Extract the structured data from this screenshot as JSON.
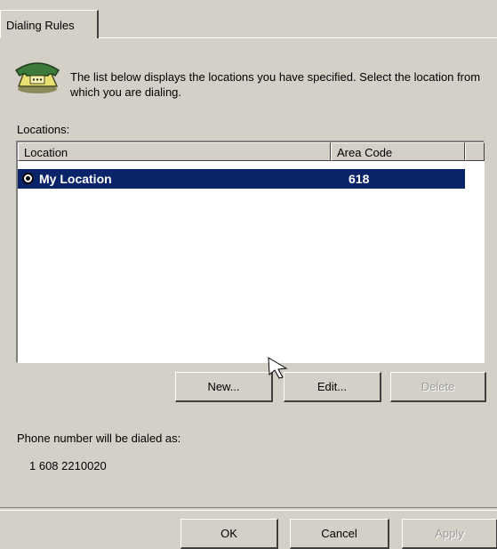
{
  "tabs": [
    {
      "label": "Dialing Rules"
    }
  ],
  "intro_text": "The list below displays the locations you have specified. Select the location from which you are dialing.",
  "locations_label": "Locations:",
  "table": {
    "columns": [
      "Location",
      "Area Code"
    ],
    "rows": [
      {
        "location": "My Location",
        "area_code": "618",
        "selected": true
      }
    ]
  },
  "buttons": {
    "new": "New...",
    "edit": "Edit...",
    "delete": "Delete",
    "ok": "OK",
    "cancel": "Cancel",
    "apply": "Apply"
  },
  "dialed_label": "Phone number will be dialed as:",
  "dialed_value": "1 608 2210020",
  "colors": {
    "face": "#d4d0c8",
    "selection": "#0a246a",
    "disabled_text": "#9a9a9a"
  },
  "icons": {
    "phone": "telephone-icon",
    "radio": "radio-selected-icon",
    "cursor": "mouse-cursor-icon"
  }
}
